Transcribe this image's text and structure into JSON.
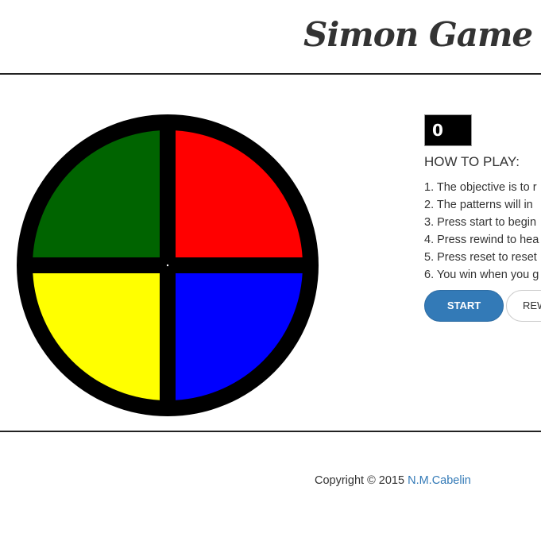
{
  "header": {
    "title": "Simon Game"
  },
  "game": {
    "count": "0",
    "colors": {
      "green": "#006400",
      "red": "#ff0000",
      "yellow": "#ffff00",
      "blue": "#0000ff",
      "frame": "#000000"
    }
  },
  "panel": {
    "heading": "HOW TO PLAY:",
    "rules": [
      "1. The objective is to r",
      "2. The patterns will in",
      "3. Press start to begin",
      "4. Press rewind to hea",
      "5. Press reset to reset",
      "6. You win when you g"
    ],
    "start_label": "START",
    "rewind_label": "REW"
  },
  "footer": {
    "copyright": "Copyright © 2015 ",
    "author": "N.M.Cabelin"
  }
}
